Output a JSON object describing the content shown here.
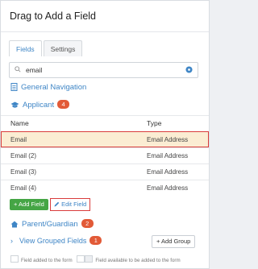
{
  "panel": {
    "title": "Drag to Add a Field",
    "tabs": [
      {
        "label": "Fields",
        "active": true
      },
      {
        "label": "Settings",
        "active": false
      }
    ],
    "search": {
      "value": "email"
    }
  },
  "sections": {
    "general_navigation": "General Navigation",
    "applicant": {
      "label": "Applicant",
      "count": "4"
    },
    "parent_guardian": {
      "label": "Parent/Guardian",
      "count": "2"
    },
    "grouped_fields": {
      "label": "View Grouped Fields",
      "count": "1"
    }
  },
  "table": {
    "headers": [
      "Name",
      "Type"
    ],
    "rows": [
      {
        "name": "Email",
        "type": "Email Address",
        "selected": true
      },
      {
        "name": "Email (2)",
        "type": "Email Address"
      },
      {
        "name": "Email (3)",
        "type": "Email Address"
      },
      {
        "name": "Email (4)",
        "type": "Email Address"
      }
    ]
  },
  "buttons": {
    "add_field": "+ Add Field",
    "edit_field": "Edit Field",
    "add_group": "+ Add Group"
  },
  "legend": {
    "added": "Field added to the form",
    "available": "Field available to be added to the form"
  },
  "colors": {
    "accent": "#3f86c6",
    "badge": "#e25a37",
    "add_button": "#45a545",
    "highlight_border": "#d93c3c",
    "selected_row": "#fbedd3"
  }
}
